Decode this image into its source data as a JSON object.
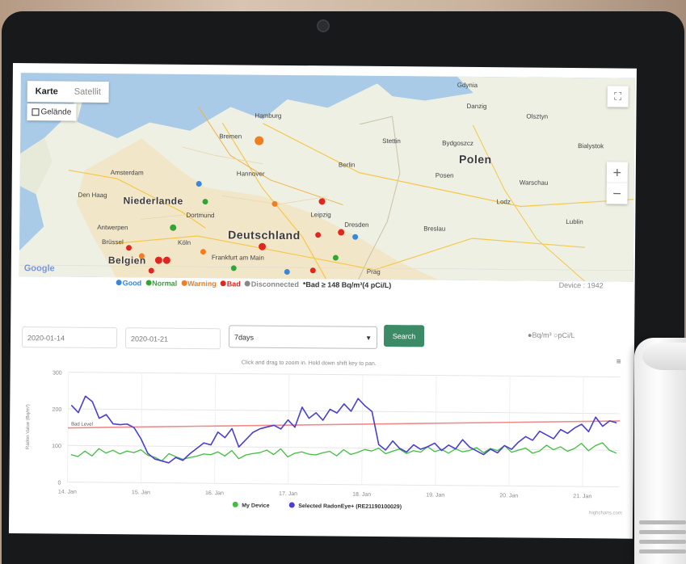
{
  "map": {
    "type_tabs": [
      "Karte",
      "Satellit"
    ],
    "terrain_label": "Gelände",
    "google_logo": "Google",
    "countries": [
      "Niederlande",
      "Deutschland",
      "Polen",
      "Belgien"
    ],
    "cities": [
      "Hamburg",
      "Bremen",
      "Amsterdam",
      "Den Haag",
      "Hannover",
      "Dortmund",
      "Berlin",
      "Leipzig",
      "Dresden",
      "Frankfurt am Main",
      "Köln",
      "Brüssel",
      "Antwerpen",
      "Posen",
      "Breslau",
      "Warschau",
      "Lodz",
      "Lublin",
      "Danzig",
      "Prag",
      "Bydgoszcz",
      "Bialystok",
      "Gdynia",
      "Olsztyn",
      "Stettin"
    ],
    "zoom_in": "+",
    "zoom_out": "−",
    "fullscreen_glyph": "⛶"
  },
  "legend": {
    "items": [
      {
        "label": "Good",
        "color": "#3a86d9"
      },
      {
        "label": "Normal",
        "color": "#33a533"
      },
      {
        "label": "Warning",
        "color": "#f07d1f"
      },
      {
        "label": "Bad",
        "color": "#e0271f"
      },
      {
        "label": "Disconnected",
        "color": "#888888"
      }
    ],
    "note": "*Bad ≥ 148 Bq/m³(4 pCi/L)",
    "device_count": "Device : 1942"
  },
  "controls": {
    "start_date": "2020-01-14",
    "end_date": "2020-01-21",
    "period": "7days",
    "search_label": "Search",
    "units": "●Bq/m³  ○pCi/L",
    "hint": "Click and drag to zoom in. Hold down shift key to pan."
  },
  "chart_data": {
    "type": "line",
    "ylabel": "Radon Value (Bq/m³)",
    "ylim": [
      0,
      300
    ],
    "yticks": [
      0,
      100,
      200,
      300
    ],
    "xticks": [
      "14. Jan",
      "15. Jan",
      "16. Jan",
      "17. Jan",
      "18. Jan",
      "19. Jan",
      "20. Jan",
      "21. Jan"
    ],
    "threshold_label": "Bad Level",
    "threshold": [
      148,
      180
    ],
    "series": [
      {
        "name": "My Device",
        "color": "#3fbf3f",
        "values": [
          75,
          70,
          85,
          72,
          92,
          80,
          88,
          78,
          86,
          82,
          90,
          75,
          70,
          60,
          80,
          72,
          65,
          70,
          74,
          80,
          78,
          86,
          75,
          90,
          68,
          78,
          82,
          85,
          92,
          80,
          96,
          74,
          84,
          88,
          82,
          80,
          86,
          90,
          78,
          95,
          82,
          88,
          96,
          92,
          100,
          85,
          92,
          98,
          86,
          94,
          90,
          105,
          92,
          98,
          88,
          100,
          92,
          96,
          104,
          90,
          102,
          96,
          110,
          92,
          98,
          104,
          90,
          96,
          112,
          100,
          108,
          96,
          104,
          118,
          98,
          112,
          120,
          100,
          92
        ]
      },
      {
        "name": "Selected RadonEye+ (RE21190100029)",
        "color": "#4a3fcf",
        "values": [
          210,
          190,
          235,
          220,
          175,
          185,
          160,
          158,
          160,
          150,
          120,
          80,
          65,
          60,
          55,
          70,
          62,
          80,
          95,
          110,
          105,
          140,
          125,
          150,
          100,
          120,
          140,
          150,
          155,
          160,
          150,
          175,
          155,
          210,
          180,
          195,
          175,
          205,
          195,
          220,
          200,
          235,
          215,
          200,
          110,
          95,
          120,
          100,
          90,
          110,
          98,
          105,
          115,
          95,
          110,
          100,
          125,
          105,
          95,
          85,
          100,
          90,
          110,
          100,
          120,
          135,
          125,
          150,
          140,
          130,
          155,
          145,
          160,
          170,
          150,
          190,
          165,
          180,
          175
        ]
      }
    ]
  },
  "credit": "highcharts.com"
}
